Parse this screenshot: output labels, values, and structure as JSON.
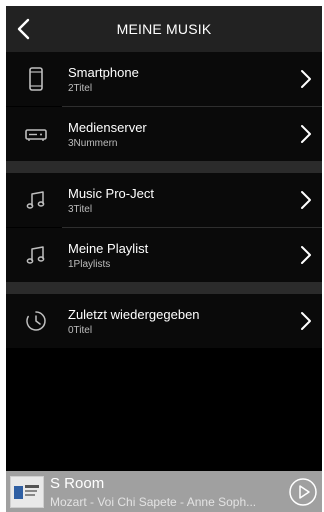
{
  "header": {
    "title": "MEINE MUSIK"
  },
  "sections": [
    {
      "items": [
        {
          "title": "Smartphone",
          "subtitle": "2Titel",
          "icon": "smartphone-icon"
        },
        {
          "title": "Medienserver",
          "subtitle": "3Nummern",
          "icon": "media-server-icon"
        }
      ]
    },
    {
      "items": [
        {
          "title": "Music Pro-Ject",
          "subtitle": "3Titel",
          "icon": "music-note-icon"
        },
        {
          "title": "Meine Playlist",
          "subtitle": "1Playlists",
          "icon": "music-note-icon"
        }
      ]
    },
    {
      "items": [
        {
          "title": "Zuletzt wiedergegeben",
          "subtitle": "0Titel",
          "icon": "clock-icon"
        }
      ]
    }
  ],
  "player": {
    "room": "S Room",
    "track": "Mozart - Voi Chi Sapete - Anne Soph..."
  },
  "colors": {
    "background": "#000000",
    "header": "#222222",
    "separator": "#2b2b2b",
    "player_bar": "#a0a0a0"
  }
}
